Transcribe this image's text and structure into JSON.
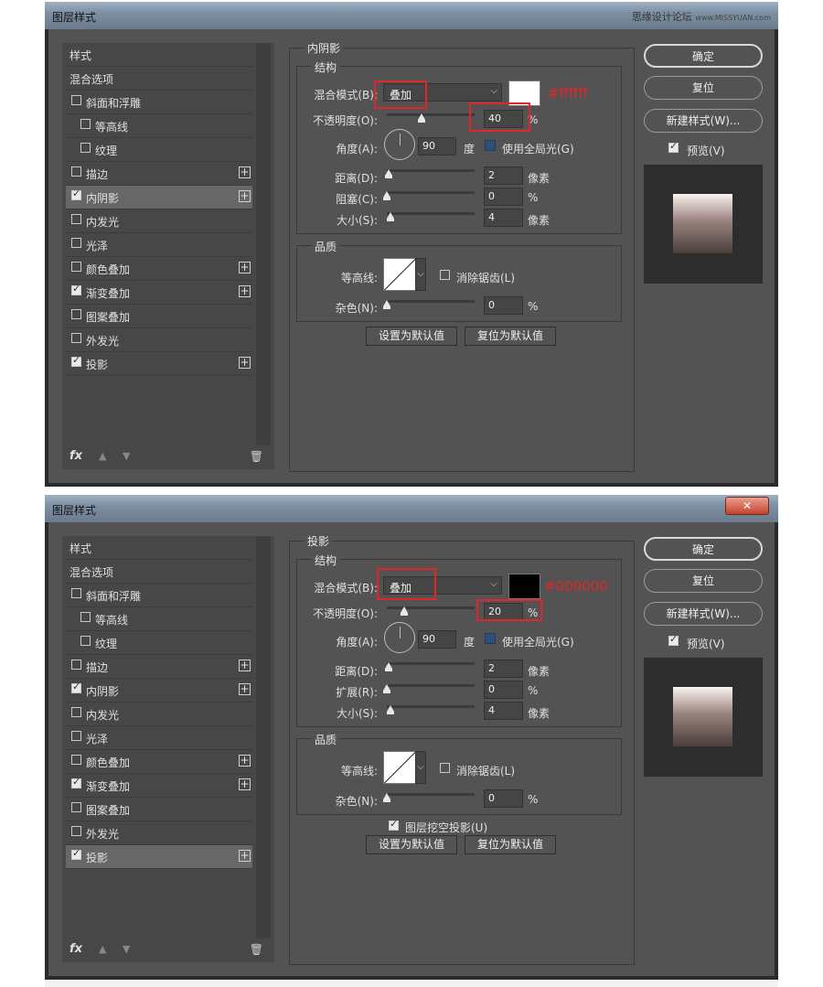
{
  "watermark": {
    "text": "思缘设计论坛",
    "sub": "www.MISSYUAN.com"
  },
  "common": {
    "title": "图层样式",
    "close_label": "✕",
    "styles_header": "样式",
    "blend_options": "混合选项",
    "items": [
      "斜面和浮雕",
      "等高线",
      "纹理",
      "描边",
      "内阴影",
      "内发光",
      "光泽",
      "颜色叠加",
      "渐变叠加",
      "图案叠加",
      "外发光",
      "投影"
    ],
    "structure_label": "结构",
    "quality_label": "品质",
    "blend_mode_label": "混合模式(B):",
    "opacity_label": "不透明度(O):",
    "angle_label": "角度(A):",
    "angle_value": "90",
    "angle_unit": "度",
    "global_light_label": "使用全局光(G)",
    "distance_label": "距离(D):",
    "size_label": "大小(S):",
    "contour_label": "等高线:",
    "antialias_label": "消除锯齿(L)",
    "noise_label": "杂色(N):",
    "noise_value": "0",
    "unit_px": "像素",
    "unit_pct": "%",
    "make_default": "设置为默认值",
    "reset_default": "复位为默认值",
    "ok": "确定",
    "reset": "复位",
    "new_style": "新建样式(W)...",
    "preview": "预览(V)",
    "fx_label": "fx",
    "trash_icon": "🗑"
  },
  "dialog1": {
    "section_title": "内阴影",
    "blend_mode": "叠加",
    "color": "#ffffff",
    "color_label": "#ffffff",
    "opacity": "40",
    "opacity_pct": 40,
    "distance": "2",
    "choke_label": "阻塞(C):",
    "choke": "0",
    "size": "4",
    "selected_item": "内阴影"
  },
  "dialog2": {
    "section_title": "投影",
    "blend_mode": "叠加",
    "color": "#000000",
    "color_label": "#000000",
    "opacity": "20",
    "opacity_pct": 20,
    "distance": "2",
    "spread_label": "扩展(R):",
    "spread": "0",
    "size": "4",
    "knockout_label": "图层挖空投影(U)",
    "selected_item": "投影"
  }
}
